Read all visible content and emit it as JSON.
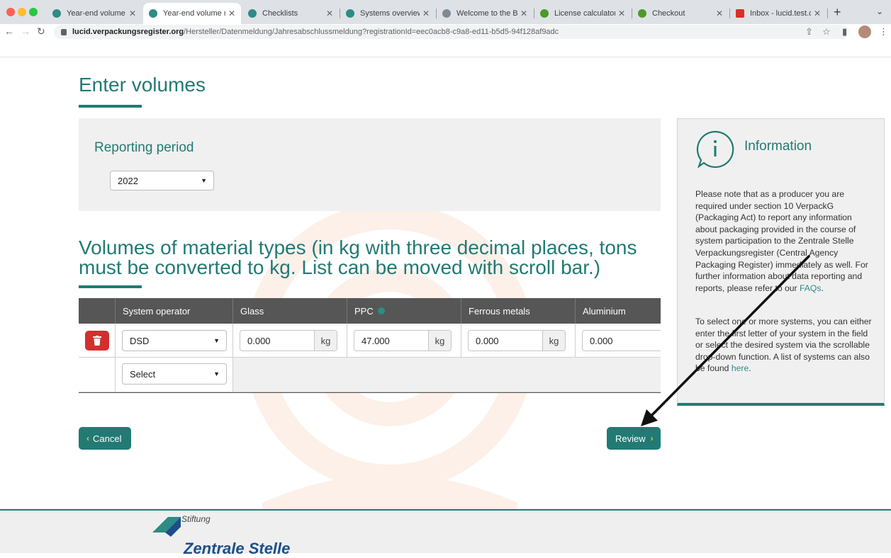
{
  "browser": {
    "tabs": [
      {
        "label": "Year-end volume repo",
        "active": false
      },
      {
        "label": "Year-end volume repo",
        "active": true
      },
      {
        "label": "Checklists",
        "active": false
      },
      {
        "label": "Systems overview",
        "active": false
      },
      {
        "label": "Welcome to the Bella",
        "active": false
      },
      {
        "label": "License calculator",
        "active": false
      },
      {
        "label": "Checkout",
        "active": false
      },
      {
        "label": "Inbox - lucid.test.co@",
        "active": false
      }
    ],
    "new_tab": "+",
    "url_host": "lucid.verpackungsregister.org",
    "url_path": "/Hersteller/Datenmeldung/Jahresabschlussmeldung?registrationId=eec0acb8-c9a8-ed11-b5d5-94f128af9adc"
  },
  "page": {
    "title": "Enter volumes",
    "reporting_period": {
      "heading": "Reporting period",
      "selected": "2022"
    },
    "volumes_heading": "Volumes of material types (in kg with three decimal places, tons must be converted to kg. List can be moved with scroll bar.)",
    "table": {
      "columns": [
        "System operator",
        "Glass",
        "PPC",
        "Ferrous metals",
        "Aluminium"
      ],
      "rows": [
        {
          "system_operator": "DSD",
          "glass": "0.000",
          "ppc": "47.000",
          "ferrous_metals": "0.000",
          "aluminium": "0.000"
        }
      ],
      "unit": "kg",
      "new_row_placeholder": "Select"
    },
    "cancel_label": "Cancel",
    "review_label": "Review"
  },
  "info": {
    "title": "Information",
    "para1_text": "Please note that as a producer you are required under section 10 VerpackG (Packaging Act) to report any information about packaging provided in the course of system participation to the Zentrale Stelle Verpackungsregister (Central Agency Packaging Register) immediately as well. For further information about data reporting and reports, please refer to our ",
    "para1_link": "FAQs",
    "para2_text": "To select one or more systems, you can either enter the first letter of your system in the field or select the desired system via the scrollable drop-down function. A list of systems can also be found ",
    "para2_link": "here"
  },
  "footer": {
    "logo_small": "Stiftung",
    "logo_big": "Zentrale Stelle"
  },
  "colors": {
    "brand": "#227a74",
    "delete": "#d32f2f",
    "chevron": "#f5c518"
  }
}
